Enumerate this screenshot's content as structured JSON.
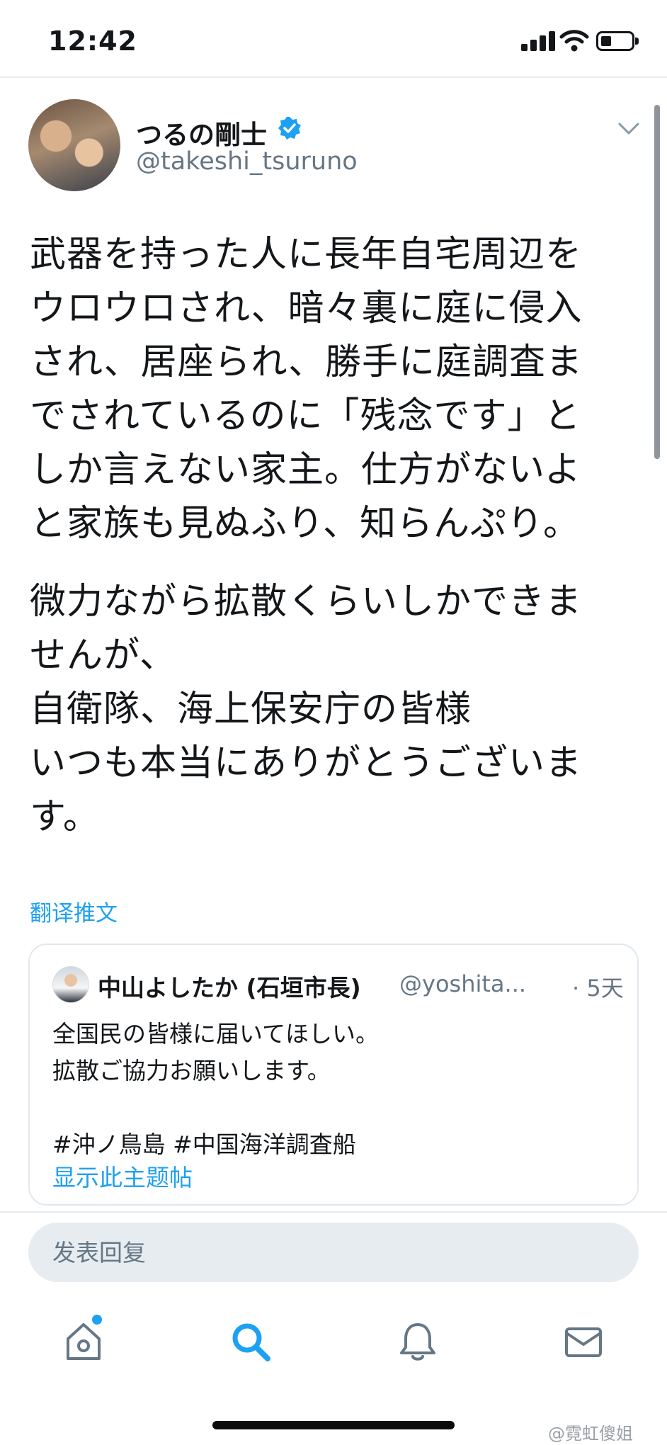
{
  "status_bar": {
    "time": "12:42"
  },
  "tweet": {
    "author_name": "つるの剛士",
    "handle": "@takeshi_tsuruno",
    "paragraph1": [
      "武器を持った人に長年自宅周辺を",
      "ウロウロされ、暗々裏に庭に侵入",
      "され、居座られ、勝手に庭調査ま",
      "でされているのに「残念です」と",
      "しか言えない家主。仕方がないよ",
      "と家族も見ぬふり、知らんぷり。"
    ],
    "paragraph2": [
      "微力ながら拡散くらいしかできま",
      "せんが、",
      "自衛隊、海上保安庁の皆様",
      "いつも本当にありがとうございま",
      "す。"
    ],
    "translate_label": "翻译推文"
  },
  "quoted_tweet": {
    "author_name": "中山よしたか (石垣市長)",
    "handle": "@yoshita...",
    "time": "· 5天",
    "lines": [
      "全国民の皆様に届いてほしい。",
      "拡散ご協力お願いします。",
      "",
      "#沖ノ鳥島 #中国海洋調査船"
    ],
    "show_thread": "显示此主题帖"
  },
  "reply": {
    "placeholder": "发表回复"
  },
  "tabs": [
    {
      "name": "home",
      "icon": "home-icon"
    },
    {
      "name": "search",
      "icon": "search-icon"
    },
    {
      "name": "notifications",
      "icon": "bell-icon"
    },
    {
      "name": "messages",
      "icon": "mail-icon"
    }
  ],
  "watermark": "@霓虹傻姐",
  "colors": {
    "accent": "#1da1f2",
    "secondary_text": "#657786",
    "text": "#14171a",
    "border": "#e1e8ed"
  }
}
